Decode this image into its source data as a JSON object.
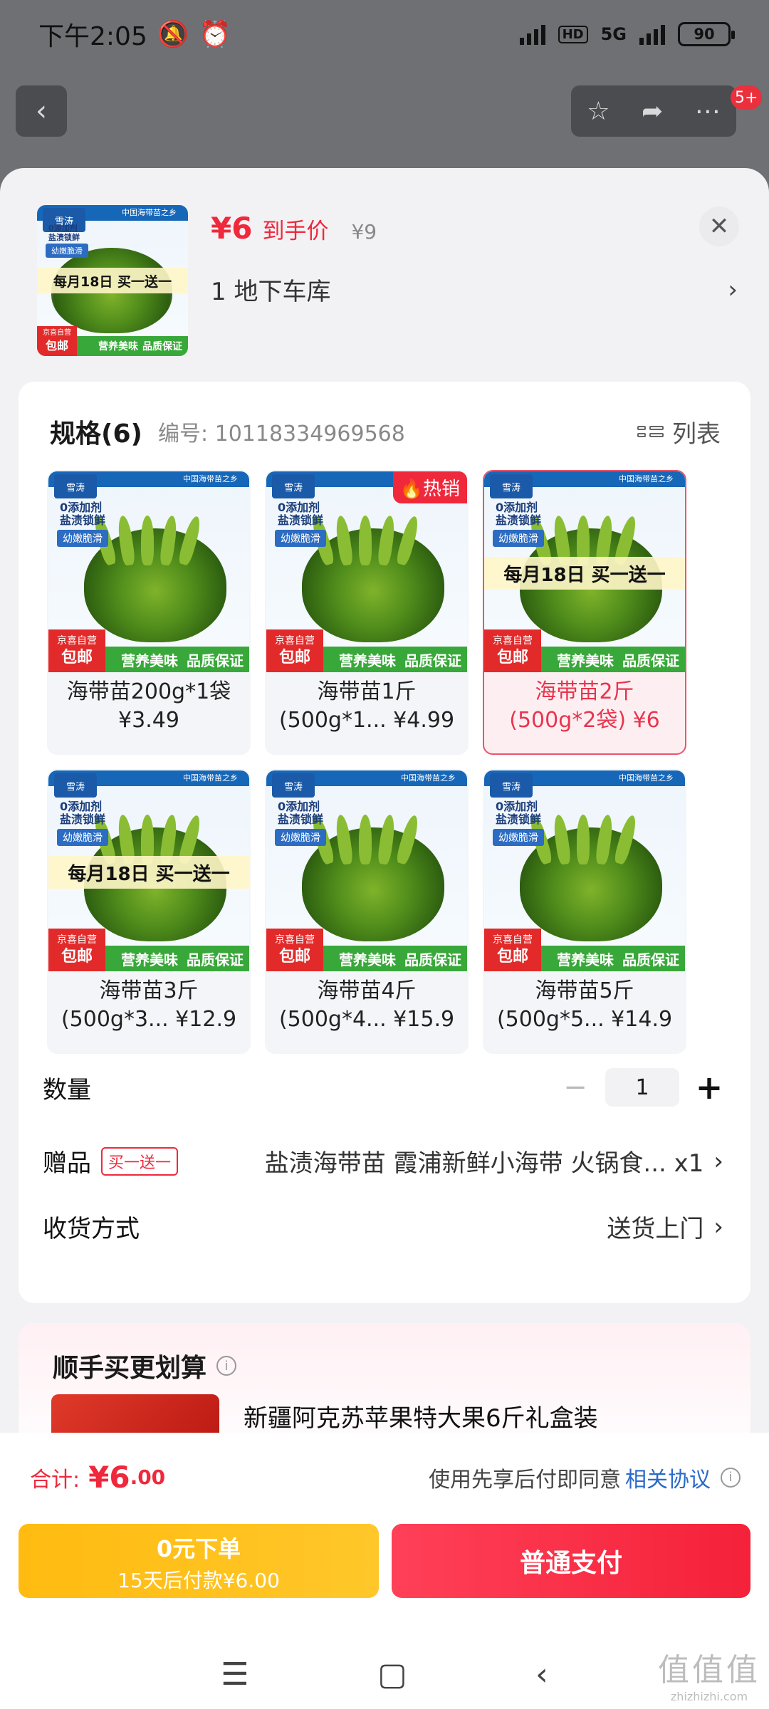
{
  "status_bar": {
    "time": "下午2:05",
    "network": "5G",
    "hd": "HD",
    "battery": "90"
  },
  "top_nav": {
    "notifications_badge": "5+"
  },
  "product": {
    "price": "¥6",
    "price_label": "到手价",
    "original_price": "¥9",
    "address": "1  地下车库",
    "thumb": {
      "brand": "雪涛",
      "banner": "中国海带苗之乡",
      "line1": "0添加剂",
      "line2": "盐渍锁鲜",
      "tag": "幼嫩脆滑",
      "promo": "每月18日 买一送一",
      "jd_top": "京喜自营",
      "jd_bottom": "包邮",
      "footer1": "营养美味",
      "footer2": "品质保证"
    }
  },
  "spec": {
    "title": "规格(6)",
    "number": "编号: 10118334969568",
    "list_label": "列表",
    "options": [
      {
        "line1": "海带苗200g*1袋",
        "line2": "¥3.49",
        "promo": "",
        "hot": ""
      },
      {
        "line1": "海带苗1斤",
        "line2": "(500g*1... ¥4.99",
        "promo": "",
        "hot": "热销"
      },
      {
        "line1": "海带苗2斤",
        "line2": "(500g*2袋) ¥6",
        "promo": "每月18日 买一送一",
        "hot": ""
      },
      {
        "line1": "海带苗3斤",
        "line2": "(500g*3... ¥12.9",
        "promo": "每月18日 买一送一",
        "hot": ""
      },
      {
        "line1": "海带苗4斤",
        "line2": "(500g*4... ¥15.9",
        "promo": "",
        "hot": ""
      },
      {
        "line1": "海带苗5斤",
        "line2": "(500g*5... ¥14.9",
        "promo": "",
        "hot": ""
      }
    ],
    "selected_index": 2
  },
  "quantity": {
    "label": "数量",
    "value": "1",
    "minus": "−",
    "plus": "+"
  },
  "gift": {
    "label": "赠品",
    "badge": "买一送一",
    "value": "盐渍海带苗 霞浦新鲜小海带 火锅食... x1"
  },
  "delivery": {
    "label": "收货方式",
    "value": "送货上门"
  },
  "upsell": {
    "title": "顺手买更划算",
    "item": "新疆阿克苏苹果特大果6斤礼盒装"
  },
  "footer": {
    "total_label": "合计:",
    "total_value": "¥6",
    "total_decimals": ".00",
    "agree_text": "使用先享后付即同意",
    "agree_link": "相关协议",
    "paylater_line1": "0元下单",
    "paylater_line2": "15天后付款¥6.00",
    "pay_label": "普通支付"
  },
  "watermark": {
    "text": "值值值",
    "url": "zhizhizhi.com"
  },
  "colors": {
    "accent": "#f0283c",
    "paylater": "#ffbb10",
    "selected_border": "#e9556a"
  }
}
